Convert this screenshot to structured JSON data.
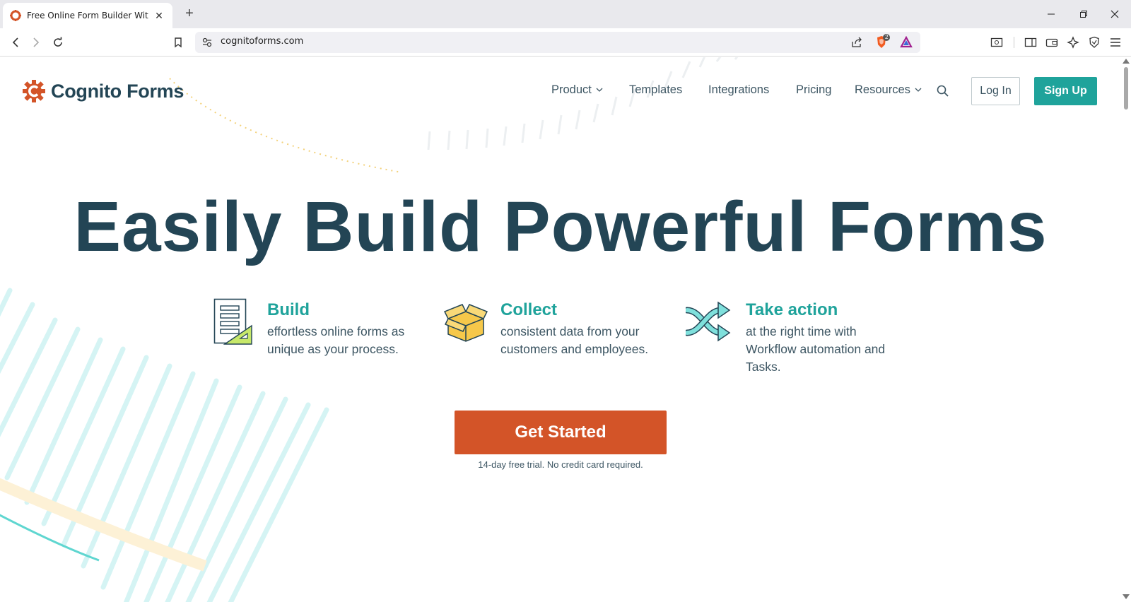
{
  "browser": {
    "tab_title": "Free Online Form Builder With Workflow",
    "url": "cognitoforms.com",
    "shields_count": "2"
  },
  "site": {
    "brand": "Cognito Forms",
    "nav": {
      "product": "Product",
      "templates": "Templates",
      "integrations": "Integrations",
      "pricing": "Pricing",
      "resources": "Resources"
    },
    "login": "Log In",
    "signup": "Sign Up"
  },
  "hero": {
    "headline": "Easily Build Powerful Forms"
  },
  "features": [
    {
      "title": "Build",
      "text": "effortless online forms as unique as your process.",
      "icon": "form-builder-icon"
    },
    {
      "title": "Collect",
      "text": "consistent data from your customers and employees.",
      "icon": "open-box-icon"
    },
    {
      "title": "Take action",
      "text": "at the right time with Workflow automation and Tasks.",
      "icon": "shuffle-arrows-icon"
    }
  ],
  "cta": {
    "label": "Get Started",
    "note": "14-day free trial. No credit card required."
  },
  "colors": {
    "brand_dark": "#234555",
    "accent_teal": "#1fa39b",
    "accent_orange": "#d35428"
  }
}
